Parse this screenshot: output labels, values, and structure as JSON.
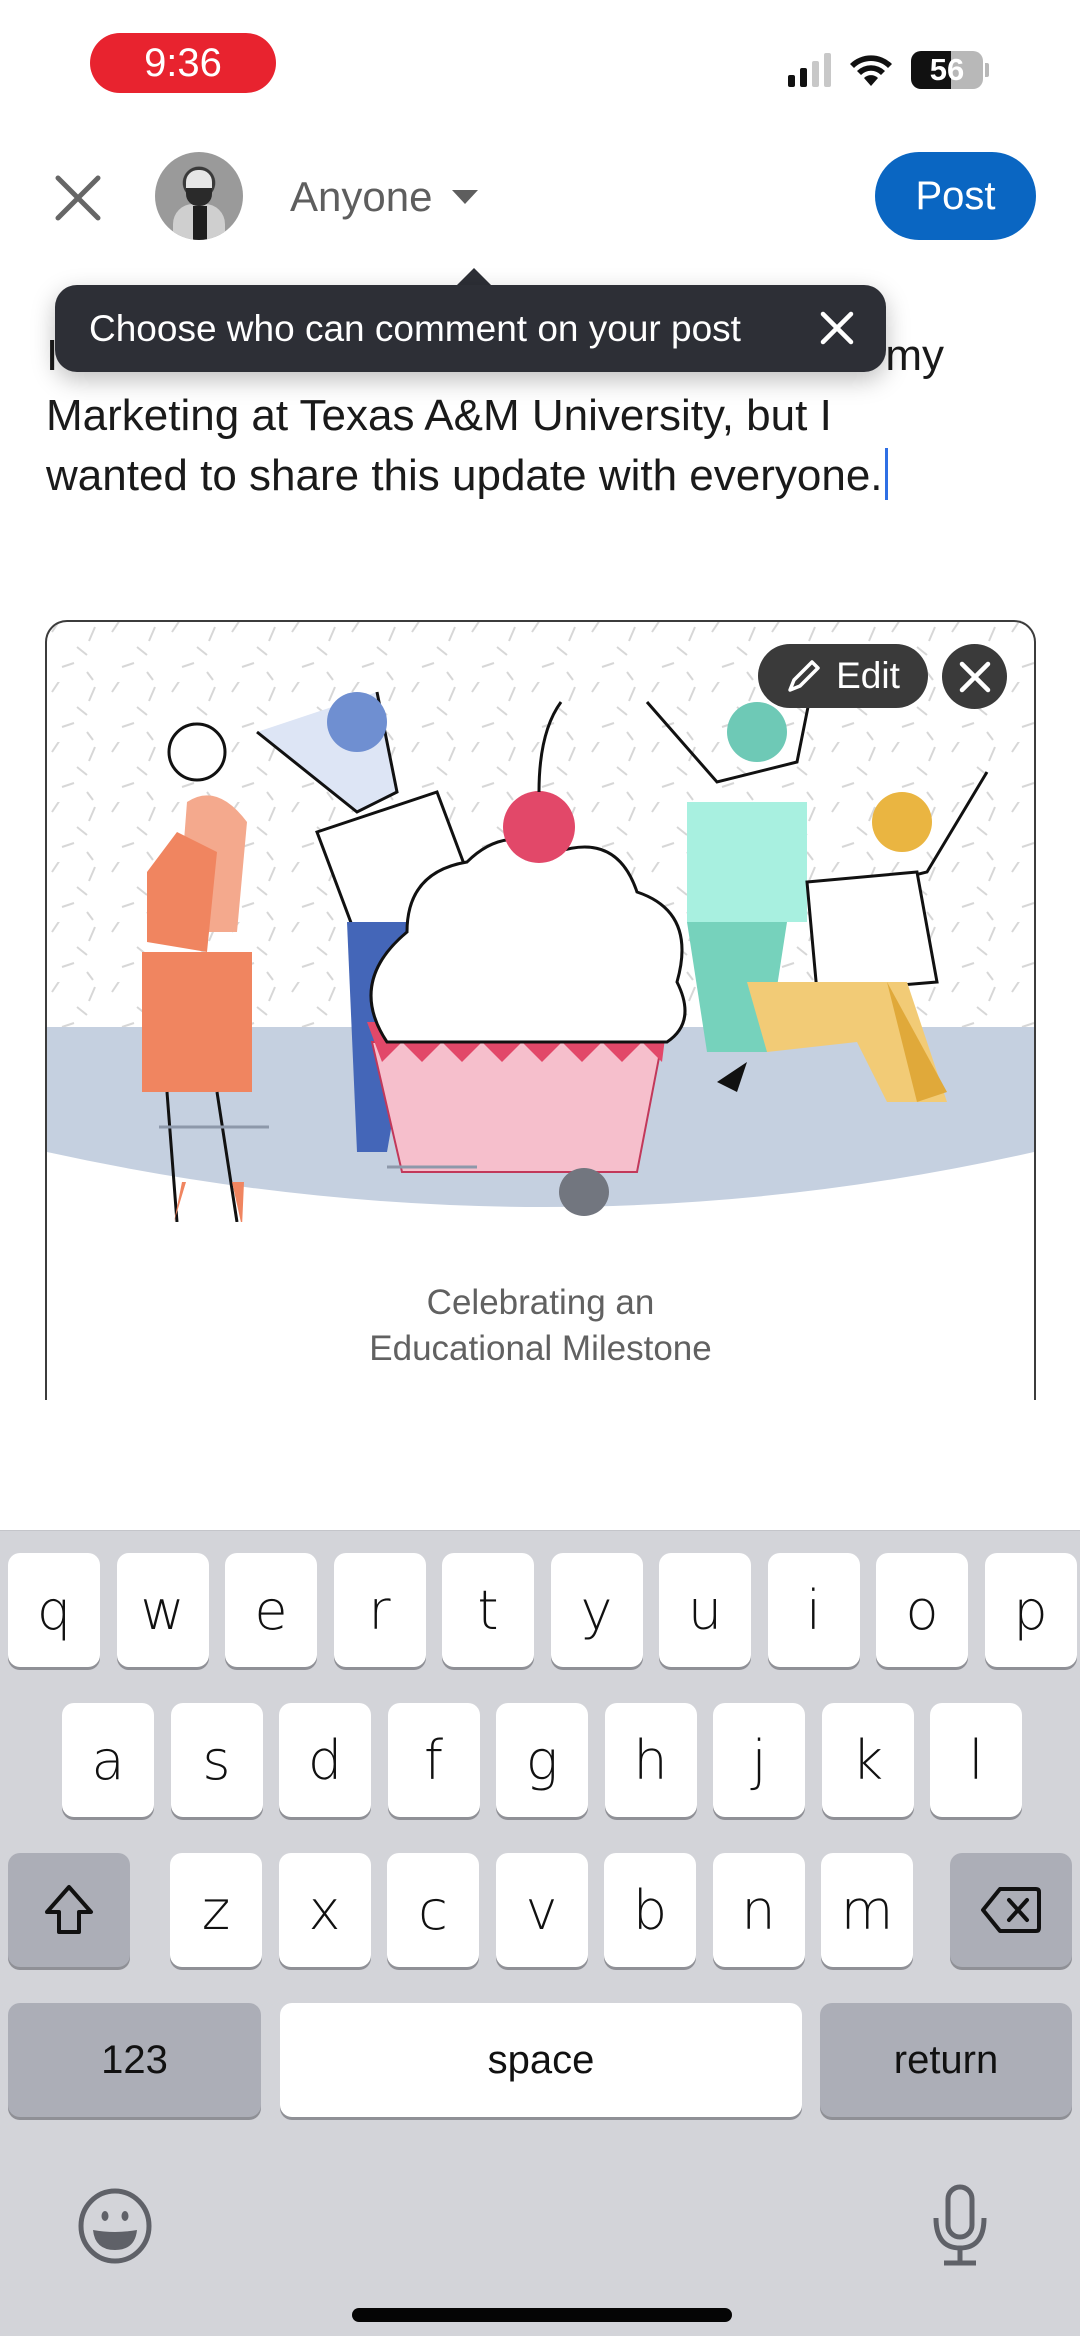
{
  "status_bar": {
    "time": "9:36",
    "battery_level": "56",
    "signal_bars_active": 2,
    "signal_bars_total": 4,
    "time_pill_color": "#e8232f"
  },
  "header": {
    "close_icon": "close-icon",
    "avatar_alt": "Profile photo",
    "audience_label": "Anyone",
    "post_label": "Post",
    "post_button_color": "#0a66c2"
  },
  "tooltip": {
    "text": "Choose who can comment on your post",
    "close_icon": "close-icon"
  },
  "post": {
    "line1_visible_start": "I",
    "line1_visible_end": "my",
    "line2": "Marketing at Texas A&M University, but I",
    "line3": "wanted to share this update with everyone."
  },
  "card": {
    "edit_label": "Edit",
    "caption_line1": "Celebrating an",
    "caption_line2": "Educational Milestone"
  },
  "keyboard": {
    "row1": [
      "q",
      "w",
      "e",
      "r",
      "t",
      "y",
      "u",
      "i",
      "o",
      "p"
    ],
    "row2": [
      "a",
      "s",
      "d",
      "f",
      "g",
      "h",
      "j",
      "k",
      "l"
    ],
    "row3": [
      "z",
      "x",
      "c",
      "v",
      "b",
      "n",
      "m"
    ],
    "numbers_label": "123",
    "space_label": "space",
    "return_label": "return"
  }
}
